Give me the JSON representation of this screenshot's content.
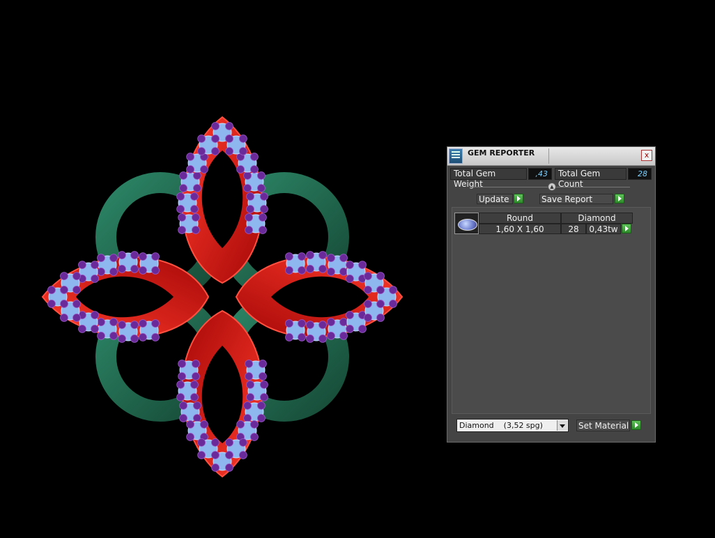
{
  "panel": {
    "title": "GEM REPORTER",
    "close_glyph": "x",
    "total_gem_weight_label": "Total Gem Weight",
    "total_gem_weight_value": ",43",
    "total_gem_count_label": "Total Gem Count",
    "total_gem_count_value": "28",
    "update_label": "Update",
    "save_report_label": "Save Report",
    "gems": [
      {
        "shape": "Round",
        "material": "Diamond",
        "size": "1,60 X 1,60",
        "count": "28",
        "weight": "0,43tw"
      }
    ],
    "material_select": {
      "selected": "Diamond    (3,52 spg)"
    },
    "set_material_label": "Set Material"
  },
  "viewport": {
    "object": "ring-model",
    "colors": {
      "background": "#000000",
      "metal_red": "#d01414",
      "band_green": "#1f6b4f",
      "gem_blue": "#8fb7ef",
      "prong_purple": "#6a2a9a"
    }
  },
  "icons": [
    "gem-reporter-icon",
    "close-icon",
    "collapse-icon",
    "play-arrow-icon",
    "dropdown-arrow-icon",
    "round-gem-icon"
  ]
}
